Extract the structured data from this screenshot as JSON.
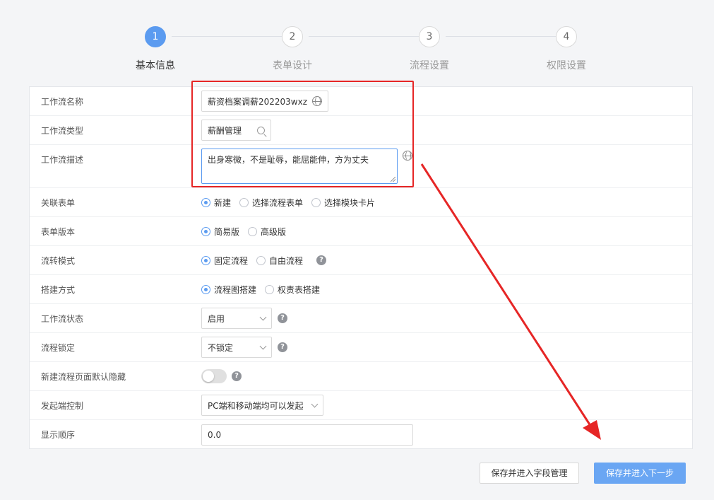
{
  "steps": [
    {
      "number": "1",
      "label": "基本信息"
    },
    {
      "number": "2",
      "label": "表单设计"
    },
    {
      "number": "3",
      "label": "流程设置"
    },
    {
      "number": "4",
      "label": "权限设置"
    }
  ],
  "form": {
    "name": {
      "label": "工作流名称",
      "value": "薪资档案调薪202203wxz"
    },
    "type": {
      "label": "工作流类型",
      "value": "薪酬管理"
    },
    "desc": {
      "label": "工作流描述",
      "value": "出身寒微，不是耻辱，能屈能伸，方为丈夫"
    },
    "form_link": {
      "label": "关联表单",
      "options": [
        "新建",
        "选择流程表单",
        "选择模块卡片"
      ]
    },
    "form_version": {
      "label": "表单版本",
      "options": [
        "简易版",
        "高级版"
      ]
    },
    "flow_mode": {
      "label": "流转模式",
      "options": [
        "固定流程",
        "自由流程"
      ]
    },
    "build_mode": {
      "label": "搭建方式",
      "options": [
        "流程图搭建",
        "权责表搭建"
      ]
    },
    "status": {
      "label": "工作流状态",
      "value": "启用"
    },
    "lock": {
      "label": "流程锁定",
      "value": "不锁定"
    },
    "hide_default": {
      "label": "新建流程页面默认隐藏",
      "on": false
    },
    "initiator": {
      "label": "发起端控制",
      "value": "PC端和移动端均可以发起"
    },
    "order": {
      "label": "显示顺序",
      "value": "0.0"
    }
  },
  "help_glyph": "?",
  "buttons": {
    "save_fields": "保存并进入字段管理",
    "save_next": "保存并进入下一步"
  },
  "colors": {
    "primary": "#5b9bf0",
    "annotation": "#e62626"
  }
}
